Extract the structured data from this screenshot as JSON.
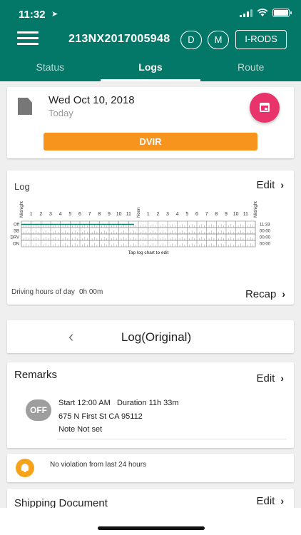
{
  "status_bar": {
    "time": "11:32",
    "location_icon": "location-arrow-icon"
  },
  "header": {
    "device_id": "213NX2017005948",
    "btn_d": "D",
    "btn_m": "M",
    "btn_irods": "I-RODS",
    "bg_color": "#047868"
  },
  "tabs": [
    {
      "label": "Status",
      "active": false
    },
    {
      "label": "Logs",
      "active": true
    },
    {
      "label": "Route",
      "active": false
    }
  ],
  "date_card": {
    "date": "Wed Oct 10, 2018",
    "sub": "Today",
    "dvir_label": "DVIR",
    "dvir_color": "#f7941d",
    "fab_color": "#e8336b"
  },
  "log_card": {
    "title": "Log",
    "edit_label": "Edit",
    "hours": [
      "Midnight",
      "1",
      "2",
      "3",
      "4",
      "5",
      "6",
      "7",
      "8",
      "9",
      "10",
      "11",
      "Noon",
      "1",
      "2",
      "3",
      "4",
      "5",
      "6",
      "7",
      "8",
      "9",
      "10",
      "11",
      "Midnight"
    ],
    "rows": [
      {
        "label": "Off",
        "total": "11:33"
      },
      {
        "label": "SB",
        "total": "00:00"
      },
      {
        "label": "DRV",
        "total": "00:00"
      },
      {
        "label": "ON",
        "total": "00:00"
      }
    ],
    "tap_hint": "Tap log chart to edit",
    "driving_label": "Driving hours of day",
    "driving_value": "0h 00m",
    "recap_label": "Recap"
  },
  "log_nav": {
    "title": "Log(Original)"
  },
  "remarks": {
    "title": "Remarks",
    "edit_label": "Edit",
    "status_badge": "OFF",
    "start": "Start 12:00 AM",
    "duration": "Duration 11h 33m",
    "address": "675 N First St CA 95112",
    "note": "Note Not set"
  },
  "violation": {
    "text": "No violation from last 24 hours"
  },
  "shipping": {
    "title": "Shipping Document",
    "edit_label": "Edit"
  }
}
